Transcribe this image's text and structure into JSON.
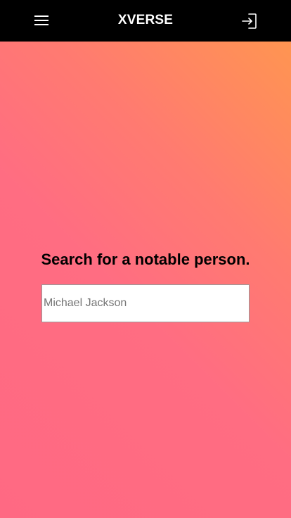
{
  "header": {
    "brand": "XVERSE",
    "menu_icon": "hamburger-menu-icon",
    "login_icon": "sign-in-icon"
  },
  "main": {
    "headline": "Search for a notable person.",
    "search": {
      "placeholder": "Michael Jackson",
      "value": ""
    }
  },
  "colors": {
    "header_bg": "#000000",
    "gradient_top_right": "#ff9551",
    "gradient_bottom_left": "#ff6983",
    "text": "#000000"
  }
}
